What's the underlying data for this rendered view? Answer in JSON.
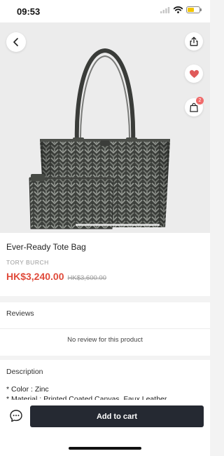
{
  "status_bar": {
    "time": "09:53",
    "icons": [
      "signal-icon",
      "wifi-icon",
      "battery-icon"
    ],
    "battery_level": 0.55,
    "battery_color": "#f2c500"
  },
  "hero": {
    "actions": [
      "back-icon",
      "share-icon",
      "heart-icon",
      "cart-icon"
    ],
    "cart_count": "2",
    "heart_color": "#e05a5a"
  },
  "product": {
    "title": "Ever-Ready Tote Bag",
    "brand": "TORY BURCH",
    "price_sale": "HK$3,240.00",
    "price_original": "HK$3,600.00",
    "sale_color": "#e04b3b"
  },
  "reviews": {
    "heading": "Reviews",
    "empty_text": "No review for this product"
  },
  "description": {
    "heading": "Description",
    "lines": [
      "* Color : Zinc",
      "* Material : Printed Coated Canvas, Faux Leather"
    ]
  },
  "bottom_bar": {
    "chat_icon": "chat-bubble-icon",
    "add_to_cart_label": "Add to cart",
    "button_color": "#252932"
  }
}
